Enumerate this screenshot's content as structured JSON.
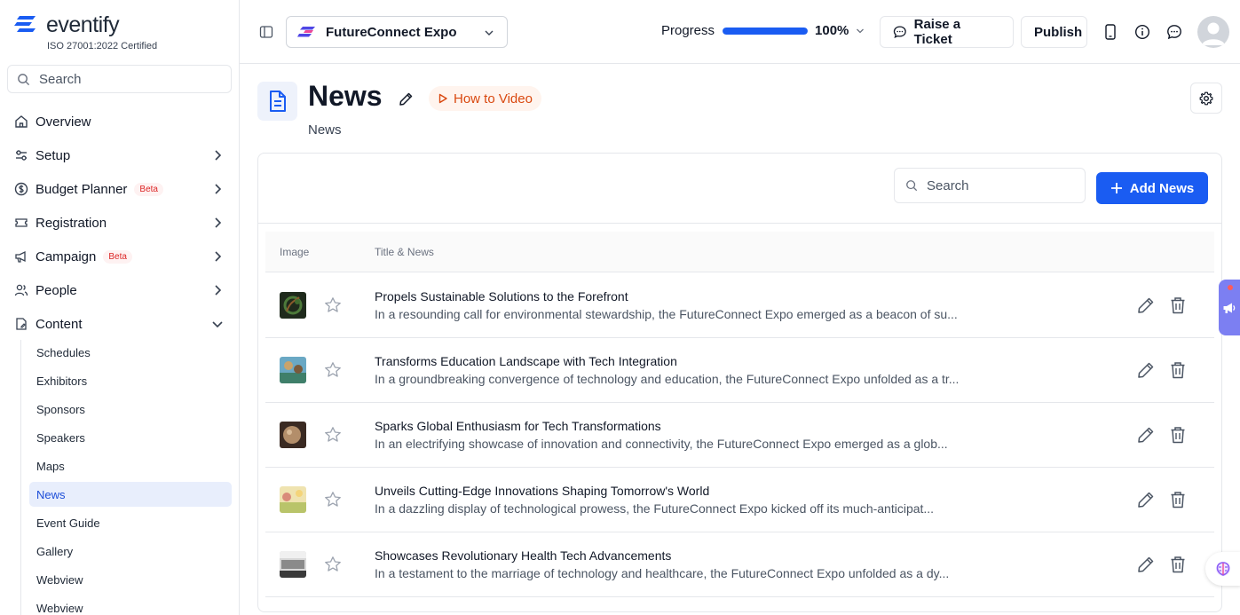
{
  "brand": {
    "name": "eventify",
    "certification": "ISO 27001:2022 Certified"
  },
  "sidebar": {
    "search_placeholder": "Search",
    "items": [
      {
        "label": "Overview",
        "icon": "home-icon"
      },
      {
        "label": "Setup",
        "icon": "sliders-icon"
      },
      {
        "label": "Budget Planner",
        "icon": "dollar-circle-icon",
        "badge": "Beta"
      },
      {
        "label": "Registration",
        "icon": "ticket-icon"
      },
      {
        "label": "Campaign",
        "icon": "megaphone-icon",
        "badge": "Beta"
      },
      {
        "label": "People",
        "icon": "users-icon"
      },
      {
        "label": "Content",
        "icon": "content-icon"
      }
    ],
    "content_subitems": [
      "Schedules",
      "Exhibitors",
      "Sponsors",
      "Speakers",
      "Maps",
      "News",
      "Event Guide",
      "Gallery",
      "Webview",
      "Webview"
    ],
    "active_subitem": "News"
  },
  "topbar": {
    "event_name": "FutureConnect Expo",
    "progress_label": "Progress",
    "progress_value": "100%",
    "progress_fraction": 1.0,
    "raise_ticket_label": "Raise a Ticket",
    "publish_label": "Publish"
  },
  "page": {
    "title": "News",
    "subtitle": "News",
    "how_to_video_label": "How to Video"
  },
  "toolbar": {
    "search_placeholder": "Search",
    "add_label": "Add News"
  },
  "table": {
    "columns": [
      "Image",
      "Title & News"
    ],
    "rows": [
      {
        "title": "Propels Sustainable Solutions to the Forefront",
        "description": "In a resounding call for environmental stewardship, the FutureConnect Expo emerged as a beacon of su..."
      },
      {
        "title": "Transforms Education Landscape with Tech Integration",
        "description": "In a groundbreaking convergence of technology and education, the FutureConnect Expo unfolded as a tr..."
      },
      {
        "title": "Sparks Global Enthusiasm for Tech Transformations",
        "description": "In an electrifying showcase of innovation and connectivity, the FutureConnect Expo emerged as a glob..."
      },
      {
        "title": "Unveils Cutting-Edge Innovations Shaping Tomorrow's World",
        "description": "In a dazzling display of technological prowess, the FutureConnect Expo kicked off its much-anticipat..."
      },
      {
        "title": "Showcases Revolutionary Health Tech Advancements",
        "description": "In a testament to the marriage of technology and healthcare, the FutureConnect Expo unfolded as a dy..."
      }
    ]
  },
  "colors": {
    "accent": "#1a5cf2",
    "active_bg": "#e8eefc",
    "beta": "#dc2626",
    "how_to": "#d9480f",
    "float_tab": "#7c7ff2"
  }
}
